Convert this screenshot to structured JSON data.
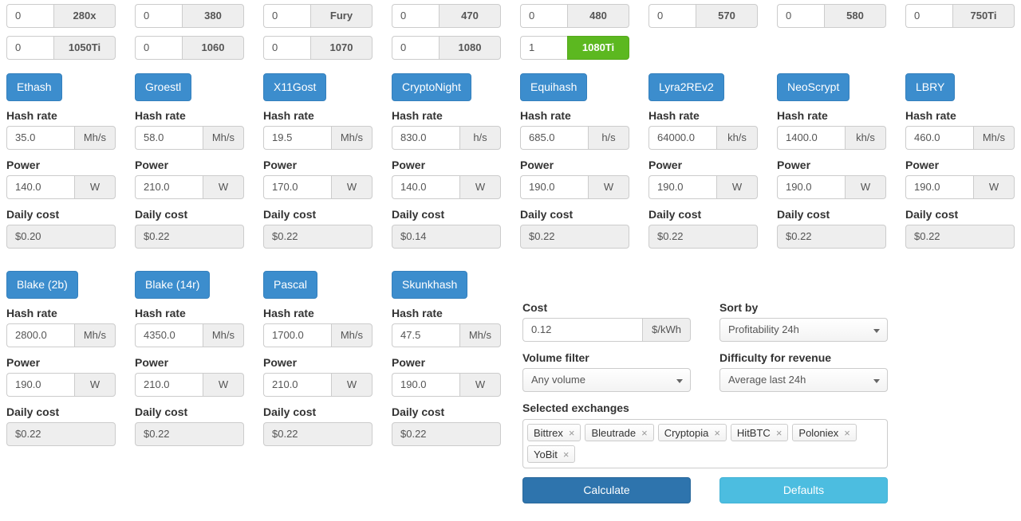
{
  "gpus": [
    {
      "count": "0",
      "model": "280x",
      "selected": false
    },
    {
      "count": "0",
      "model": "380",
      "selected": false
    },
    {
      "count": "0",
      "model": "Fury",
      "selected": false
    },
    {
      "count": "0",
      "model": "470",
      "selected": false
    },
    {
      "count": "0",
      "model": "480",
      "selected": false
    },
    {
      "count": "0",
      "model": "570",
      "selected": false
    },
    {
      "count": "0",
      "model": "580",
      "selected": false
    },
    {
      "count": "0",
      "model": "750Ti",
      "selected": false
    },
    {
      "count": "0",
      "model": "1050Ti",
      "selected": false
    },
    {
      "count": "0",
      "model": "1060",
      "selected": false
    },
    {
      "count": "0",
      "model": "1070",
      "selected": false
    },
    {
      "count": "0",
      "model": "1080",
      "selected": false
    },
    {
      "count": "1",
      "model": "1080Ti",
      "selected": true
    }
  ],
  "labels": {
    "hash_rate": "Hash rate",
    "power": "Power",
    "daily_cost": "Daily cost",
    "power_unit": "W"
  },
  "algorithms": [
    {
      "name": "Ethash",
      "hashrate": "35.0",
      "hash_unit": "Mh/s",
      "power": "140.0",
      "daily_cost": "$0.20"
    },
    {
      "name": "Groestl",
      "hashrate": "58.0",
      "hash_unit": "Mh/s",
      "power": "210.0",
      "daily_cost": "$0.22"
    },
    {
      "name": "X11Gost",
      "hashrate": "19.5",
      "hash_unit": "Mh/s",
      "power": "170.0",
      "daily_cost": "$0.22"
    },
    {
      "name": "CryptoNight",
      "hashrate": "830.0",
      "hash_unit": "h/s",
      "power": "140.0",
      "daily_cost": "$0.14"
    },
    {
      "name": "Equihash",
      "hashrate": "685.0",
      "hash_unit": "h/s",
      "power": "190.0",
      "daily_cost": "$0.22"
    },
    {
      "name": "Lyra2REv2",
      "hashrate": "64000.0",
      "hash_unit": "kh/s",
      "power": "190.0",
      "daily_cost": "$0.22"
    },
    {
      "name": "NeoScrypt",
      "hashrate": "1400.0",
      "hash_unit": "kh/s",
      "power": "190.0",
      "daily_cost": "$0.22"
    },
    {
      "name": "LBRY",
      "hashrate": "460.0",
      "hash_unit": "Mh/s",
      "power": "190.0",
      "daily_cost": "$0.22"
    },
    {
      "name": "Blake (2b)",
      "hashrate": "2800.0",
      "hash_unit": "Mh/s",
      "power": "190.0",
      "daily_cost": "$0.22"
    },
    {
      "name": "Blake (14r)",
      "hashrate": "4350.0",
      "hash_unit": "Mh/s",
      "power": "210.0",
      "daily_cost": "$0.22"
    },
    {
      "name": "Pascal",
      "hashrate": "1700.0",
      "hash_unit": "Mh/s",
      "power": "210.0",
      "daily_cost": "$0.22"
    },
    {
      "name": "Skunkhash",
      "hashrate": "47.5",
      "hash_unit": "Mh/s",
      "power": "190.0",
      "daily_cost": "$0.22"
    }
  ],
  "settings": {
    "cost": {
      "label": "Cost",
      "value": "0.12",
      "unit": "$/kWh"
    },
    "sort_by": {
      "label": "Sort by",
      "value": "Profitability 24h"
    },
    "volume_filter": {
      "label": "Volume filter",
      "value": "Any volume"
    },
    "difficulty": {
      "label": "Difficulty for revenue",
      "value": "Average last 24h"
    },
    "exchanges": {
      "label": "Selected exchanges",
      "items": [
        "Bittrex",
        "Bleutrade",
        "Cryptopia",
        "HitBTC",
        "Poloniex",
        "YoBit"
      ],
      "remove_glyph": "×"
    },
    "calculate_label": "Calculate",
    "defaults_label": "Defaults"
  },
  "colors": {
    "algo_button": "#3c8dcd",
    "gpu_selected": "#5cb820",
    "calculate": "#2e74ad",
    "defaults": "#4cbde0"
  }
}
